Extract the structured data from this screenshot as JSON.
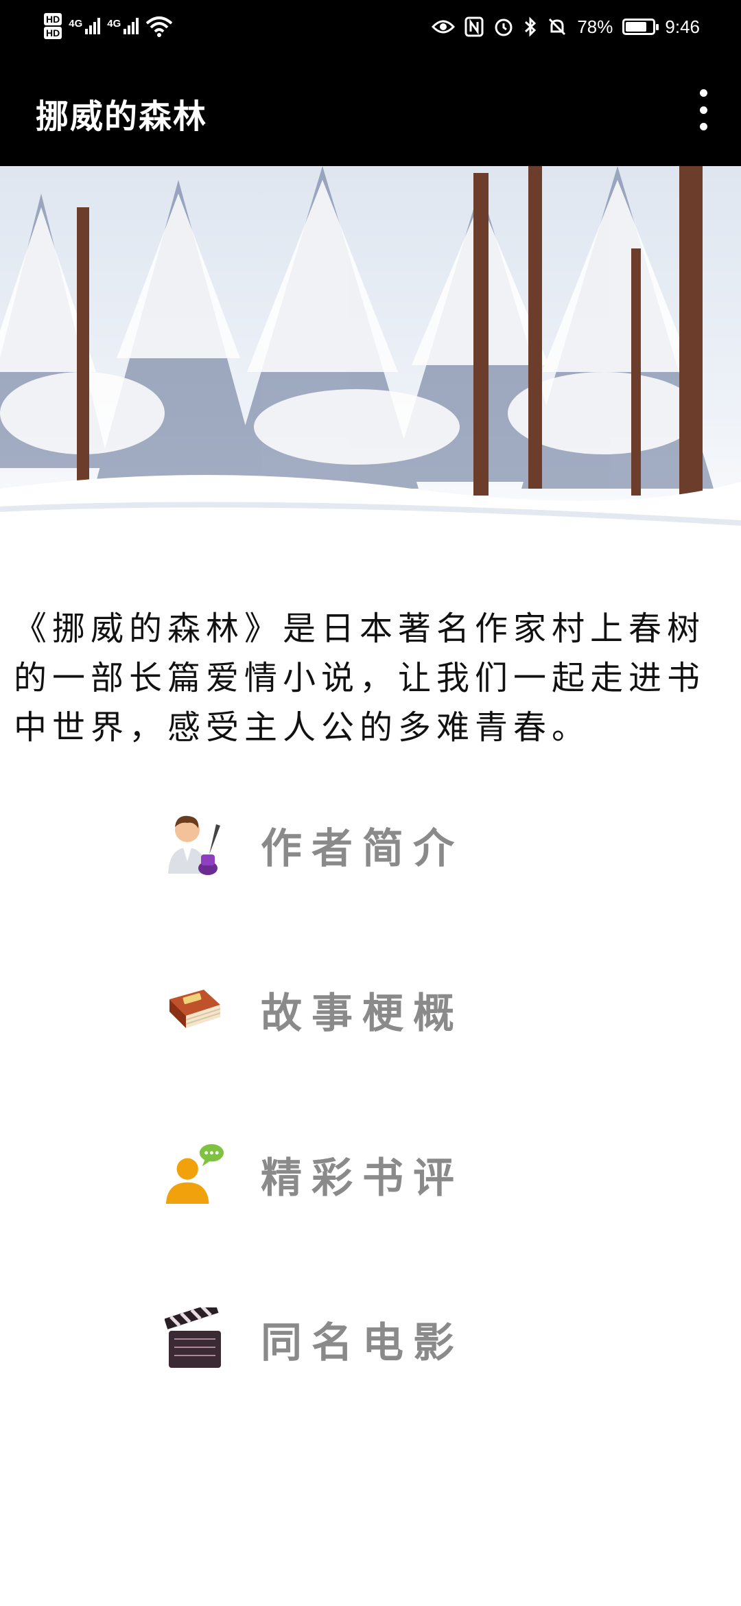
{
  "status_bar": {
    "hd1": "HD",
    "hd2": "HD",
    "net1": "4G",
    "net2": "4G",
    "battery_percent": "78%",
    "battery_level": 0.78,
    "time": "9:46"
  },
  "app_bar": {
    "title": "挪威的森林",
    "menu_icon": "more-vert-icon"
  },
  "hero_image": {
    "description_icon": "snowy-forest-image"
  },
  "intro_text": "《挪威的森林》是日本著名作家村上春树的一部长篇爱情小说，让我们一起走进书中世界，感受主人公的多难青春。",
  "menu": {
    "items": [
      {
        "label": "作者简介",
        "icon": "author-icon"
      },
      {
        "label": "故事梗概",
        "icon": "story-book-icon"
      },
      {
        "label": "精彩书评",
        "icon": "comment-user-icon"
      },
      {
        "label": "同名电影",
        "icon": "clapperboard-icon"
      }
    ]
  },
  "colors": {
    "app_bar_bg": "#000000",
    "menu_label": "#8a8a8a"
  }
}
